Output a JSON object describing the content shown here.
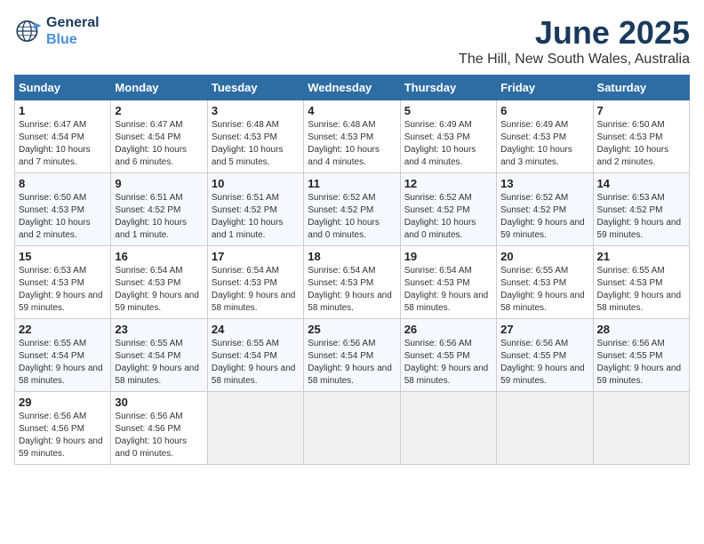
{
  "logo": {
    "line1": "General",
    "line2": "Blue"
  },
  "title": "June 2025",
  "subtitle": "The Hill, New South Wales, Australia",
  "days_of_week": [
    "Sunday",
    "Monday",
    "Tuesday",
    "Wednesday",
    "Thursday",
    "Friday",
    "Saturday"
  ],
  "weeks": [
    [
      {
        "day": "1",
        "info": "Sunrise: 6:47 AM\nSunset: 4:54 PM\nDaylight: 10 hours and 7 minutes."
      },
      {
        "day": "2",
        "info": "Sunrise: 6:47 AM\nSunset: 4:54 PM\nDaylight: 10 hours and 6 minutes."
      },
      {
        "day": "3",
        "info": "Sunrise: 6:48 AM\nSunset: 4:53 PM\nDaylight: 10 hours and 5 minutes."
      },
      {
        "day": "4",
        "info": "Sunrise: 6:48 AM\nSunset: 4:53 PM\nDaylight: 10 hours and 4 minutes."
      },
      {
        "day": "5",
        "info": "Sunrise: 6:49 AM\nSunset: 4:53 PM\nDaylight: 10 hours and 4 minutes."
      },
      {
        "day": "6",
        "info": "Sunrise: 6:49 AM\nSunset: 4:53 PM\nDaylight: 10 hours and 3 minutes."
      },
      {
        "day": "7",
        "info": "Sunrise: 6:50 AM\nSunset: 4:53 PM\nDaylight: 10 hours and 2 minutes."
      }
    ],
    [
      {
        "day": "8",
        "info": "Sunrise: 6:50 AM\nSunset: 4:53 PM\nDaylight: 10 hours and 2 minutes."
      },
      {
        "day": "9",
        "info": "Sunrise: 6:51 AM\nSunset: 4:52 PM\nDaylight: 10 hours and 1 minute."
      },
      {
        "day": "10",
        "info": "Sunrise: 6:51 AM\nSunset: 4:52 PM\nDaylight: 10 hours and 1 minute."
      },
      {
        "day": "11",
        "info": "Sunrise: 6:52 AM\nSunset: 4:52 PM\nDaylight: 10 hours and 0 minutes."
      },
      {
        "day": "12",
        "info": "Sunrise: 6:52 AM\nSunset: 4:52 PM\nDaylight: 10 hours and 0 minutes."
      },
      {
        "day": "13",
        "info": "Sunrise: 6:52 AM\nSunset: 4:52 PM\nDaylight: 9 hours and 59 minutes."
      },
      {
        "day": "14",
        "info": "Sunrise: 6:53 AM\nSunset: 4:52 PM\nDaylight: 9 hours and 59 minutes."
      }
    ],
    [
      {
        "day": "15",
        "info": "Sunrise: 6:53 AM\nSunset: 4:53 PM\nDaylight: 9 hours and 59 minutes."
      },
      {
        "day": "16",
        "info": "Sunrise: 6:54 AM\nSunset: 4:53 PM\nDaylight: 9 hours and 59 minutes."
      },
      {
        "day": "17",
        "info": "Sunrise: 6:54 AM\nSunset: 4:53 PM\nDaylight: 9 hours and 58 minutes."
      },
      {
        "day": "18",
        "info": "Sunrise: 6:54 AM\nSunset: 4:53 PM\nDaylight: 9 hours and 58 minutes."
      },
      {
        "day": "19",
        "info": "Sunrise: 6:54 AM\nSunset: 4:53 PM\nDaylight: 9 hours and 58 minutes."
      },
      {
        "day": "20",
        "info": "Sunrise: 6:55 AM\nSunset: 4:53 PM\nDaylight: 9 hours and 58 minutes."
      },
      {
        "day": "21",
        "info": "Sunrise: 6:55 AM\nSunset: 4:53 PM\nDaylight: 9 hours and 58 minutes."
      }
    ],
    [
      {
        "day": "22",
        "info": "Sunrise: 6:55 AM\nSunset: 4:54 PM\nDaylight: 9 hours and 58 minutes."
      },
      {
        "day": "23",
        "info": "Sunrise: 6:55 AM\nSunset: 4:54 PM\nDaylight: 9 hours and 58 minutes."
      },
      {
        "day": "24",
        "info": "Sunrise: 6:55 AM\nSunset: 4:54 PM\nDaylight: 9 hours and 58 minutes."
      },
      {
        "day": "25",
        "info": "Sunrise: 6:56 AM\nSunset: 4:54 PM\nDaylight: 9 hours and 58 minutes."
      },
      {
        "day": "26",
        "info": "Sunrise: 6:56 AM\nSunset: 4:55 PM\nDaylight: 9 hours and 58 minutes."
      },
      {
        "day": "27",
        "info": "Sunrise: 6:56 AM\nSunset: 4:55 PM\nDaylight: 9 hours and 59 minutes."
      },
      {
        "day": "28",
        "info": "Sunrise: 6:56 AM\nSunset: 4:55 PM\nDaylight: 9 hours and 59 minutes."
      }
    ],
    [
      {
        "day": "29",
        "info": "Sunrise: 6:56 AM\nSunset: 4:56 PM\nDaylight: 9 hours and 59 minutes."
      },
      {
        "day": "30",
        "info": "Sunrise: 6:56 AM\nSunset: 4:56 PM\nDaylight: 10 hours and 0 minutes."
      },
      {
        "day": "",
        "info": ""
      },
      {
        "day": "",
        "info": ""
      },
      {
        "day": "",
        "info": ""
      },
      {
        "day": "",
        "info": ""
      },
      {
        "day": "",
        "info": ""
      }
    ]
  ]
}
